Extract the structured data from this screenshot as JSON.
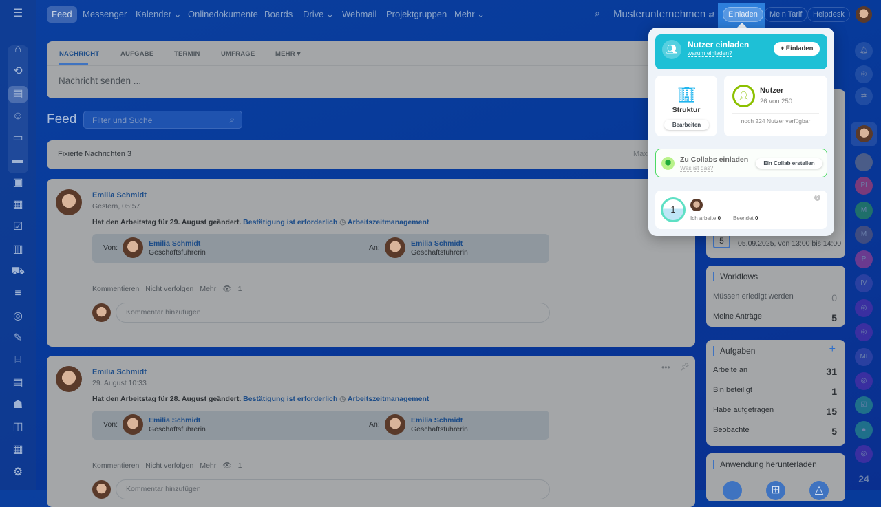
{
  "topnav": {
    "items": [
      "Feed",
      "Messenger",
      "Kalender",
      "Onlinedokumente",
      "Boards",
      "Drive",
      "Webmail",
      "Projektgruppen",
      "Mehr"
    ],
    "company": "Musterunternehmen",
    "invite": "Einladen",
    "tariff": "Mein Tarif",
    "helpdesk": "Helpdesk"
  },
  "composer": {
    "tabs": [
      "NACHRICHT",
      "AUFGABE",
      "TERMIN",
      "UMFRAGE",
      "MEHR"
    ],
    "placeholder": "Nachricht senden ..."
  },
  "feed": {
    "title": "Feed",
    "filter_placeholder": "Filter und Suche",
    "pinned_label": "Fixierte Nachrichten",
    "pinned_count": "3",
    "pinned_right": "Maxi"
  },
  "posts": [
    {
      "author": "Emilia Schmidt",
      "time": "Gestern, 05:57",
      "text": "Hat den Arbeitstag für 29. August geändert.",
      "confirm": "Bestätigung ist erforderlich",
      "module": "Arbeitszeitmanagement",
      "from_label": "Von:",
      "to_label": "An:",
      "from_name": "Emilia Schmidt",
      "from_role": "Geschäftsführerin",
      "to_name": "Emilia Schmidt",
      "to_role": "Geschäftsführerin",
      "actions": [
        "Kommentieren",
        "Nicht verfolgen",
        "Mehr"
      ],
      "views": "1",
      "comment_placeholder": "Kommentar hinzufügen"
    },
    {
      "author": "Emilia Schmidt",
      "time": "29. August 10:33",
      "text": "Hat den Arbeitstag für 28. August geändert.",
      "confirm": "Bestätigung ist erforderlich",
      "module": "Arbeitszeitmanagement",
      "from_label": "Von:",
      "to_label": "An:",
      "from_name": "Emilia Schmidt",
      "from_role": "Geschäftsführerin",
      "to_name": "Emilia Schmidt",
      "to_role": "Geschäftsführerin",
      "actions": [
        "Kommentieren",
        "Nicht verfolgen",
        "Mehr"
      ],
      "views": "1",
      "comment_placeholder": "Kommentar hinzufügen"
    }
  ],
  "right": {
    "event": {
      "day": "5",
      "date": "05.09.2025, von 13:00 bis 14:00"
    },
    "workflows": {
      "title": "Workflows",
      "rows": [
        {
          "label": "Müssen erledigt werden",
          "value": "0"
        },
        {
          "label": "Meine Anträge",
          "value": "5"
        }
      ]
    },
    "tasks": {
      "title": "Aufgaben",
      "add": "+",
      "rows": [
        {
          "label": "Arbeite an",
          "value": "31"
        },
        {
          "label": "Bin beteiligt",
          "value": "1"
        },
        {
          "label": "Habe aufgetragen",
          "value": "15"
        },
        {
          "label": "Beobachte",
          "value": "5"
        }
      ]
    },
    "apps": {
      "title": "Anwendung herunterladen"
    }
  },
  "rightstrip": {
    "initials": [
      "Pl",
      "M",
      "M",
      "P",
      "IV",
      "MI"
    ],
    "logo": "24"
  },
  "popup": {
    "title": "Nutzer einladen",
    "why": "warum einladen?",
    "invite_btn": "+ Einladen",
    "structure": "Struktur",
    "edit": "Bearbeiten",
    "users_title": "Nutzer",
    "users_count": "26 von 250",
    "users_free": "noch 224 Nutzer verfügbar",
    "collab_title": "Zu Collabs einladen",
    "collab_what": "Was ist das?",
    "collab_btn": "Ein Collab erstellen",
    "working_count": "1",
    "working_label": "Ich arbeite",
    "working_value": "0",
    "done_label": "Beendet",
    "done_value": "0",
    "help": "?"
  },
  "colors": {
    "accent": "#1ec0d6",
    "collab_border": "#4cd964",
    "users_ring": "#8cc000"
  }
}
